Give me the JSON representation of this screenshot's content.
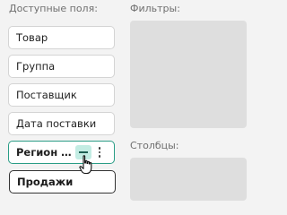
{
  "sections": {
    "fields_title": "Доступные поля:",
    "filters_title": "Фильтры:",
    "columns_title": "Столбцы:"
  },
  "fields": [
    {
      "label": "Товар"
    },
    {
      "label": "Группа"
    },
    {
      "label": "Поставщик"
    },
    {
      "label": "Дата поставки"
    },
    {
      "label": "Регион поставки",
      "state": "hover"
    }
  ],
  "dragging_field": {
    "label": "Продажи"
  },
  "icons": {
    "collapse": "minus-icon",
    "more": "more-vertical-icon",
    "cursor": "pointer-hand-icon"
  },
  "colors": {
    "accent": "#2a9d86",
    "accent_soft": "#c3ece3",
    "zone": "#dedede"
  }
}
